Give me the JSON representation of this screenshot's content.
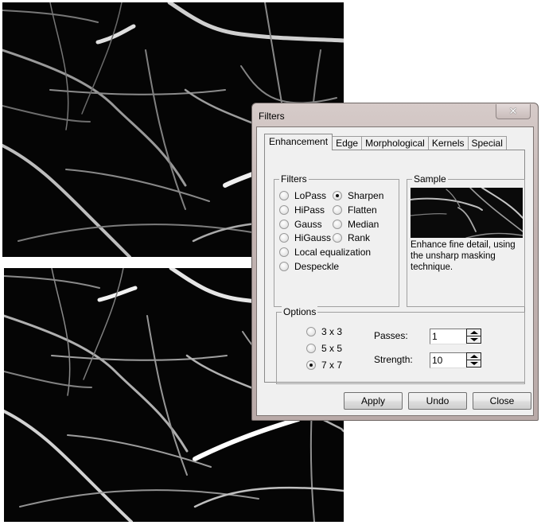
{
  "images": {
    "before": {
      "label": "original-micrograph"
    },
    "after": {
      "label": "sharpened-micrograph"
    }
  },
  "dialog": {
    "title": "Filters",
    "close_icon": "close-x-icon",
    "close_glyph": "✕",
    "tabs": [
      {
        "label": "Enhancement",
        "active": true
      },
      {
        "label": "Edge",
        "active": false
      },
      {
        "label": "Morphological",
        "active": false
      },
      {
        "label": "Kernels",
        "active": false
      },
      {
        "label": "Special",
        "active": false
      }
    ],
    "filters_group": {
      "legend": "Filters",
      "options": [
        {
          "label": "LoPass",
          "selected": false
        },
        {
          "label": "Sharpen",
          "selected": true
        },
        {
          "label": "HiPass",
          "selected": false
        },
        {
          "label": "Flatten",
          "selected": false
        },
        {
          "label": "Gauss",
          "selected": false
        },
        {
          "label": "Median",
          "selected": false
        },
        {
          "label": "HiGauss",
          "selected": false
        },
        {
          "label": "Rank",
          "selected": false
        },
        {
          "label": "Local equalization",
          "selected": false
        },
        {
          "label": "Despeckle",
          "selected": false
        }
      ]
    },
    "sample_group": {
      "legend": "Sample",
      "description": "Enhance fine detail, using the unsharp masking technique."
    },
    "options_group": {
      "legend": "Options",
      "kernel_sizes": [
        {
          "label": "3 x 3",
          "selected": false
        },
        {
          "label": "5 x 5",
          "selected": false
        },
        {
          "label": "7 x 7",
          "selected": true
        }
      ],
      "passes": {
        "label": "Passes:",
        "value": "1"
      },
      "strength": {
        "label": "Strength:",
        "value": "10"
      }
    },
    "buttons": {
      "apply": "Apply",
      "undo": "Undo",
      "close": "Close"
    }
  }
}
